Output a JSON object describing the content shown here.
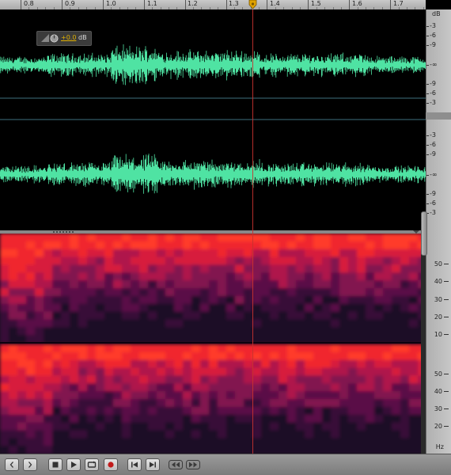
{
  "ruler": {
    "time_labels": [
      "0.8",
      "0.9",
      "1.0",
      "1.1",
      "1.2",
      "1.3",
      "1.4",
      "1.5",
      "1.6",
      "1.7"
    ]
  },
  "hud": {
    "gain_value": "+0.0",
    "gain_unit": "dB"
  },
  "amplitude_ruler": {
    "unit": "dB",
    "channel1_labels": [
      "-3",
      "-6",
      "-9",
      "-∞",
      "-9",
      "-6",
      "-3"
    ],
    "channel2_labels": [
      "-3",
      "-6",
      "-9",
      "-∞",
      "-9",
      "-6",
      "-3"
    ]
  },
  "frequency_ruler": {
    "channel1_labels": [
      "50",
      "40",
      "30",
      "20",
      "10"
    ],
    "channel2_labels": [
      "50",
      "40",
      "30",
      "20"
    ],
    "unit": "Hz"
  },
  "transport": {
    "buttons": [
      {
        "name": "nudge-left-button",
        "icon": "chevron-left-icon"
      },
      {
        "name": "nudge-right-button",
        "icon": "chevron-right-icon"
      },
      {
        "name": "stop-button",
        "icon": "stop-icon"
      },
      {
        "name": "play-button",
        "icon": "play-icon"
      },
      {
        "name": "loop-button",
        "icon": "loop-icon"
      },
      {
        "name": "record-button",
        "icon": "record-icon"
      },
      {
        "name": "go-to-start-button",
        "icon": "skip-back-icon"
      },
      {
        "name": "go-to-end-button",
        "icon": "skip-forward-icon"
      },
      {
        "name": "fast-rewind-button",
        "icon": "rewind-icon"
      },
      {
        "name": "fast-forward-button",
        "icon": "fast-forward-icon"
      }
    ]
  },
  "colors": {
    "waveform": "#4fe3a3",
    "playhead": "#c8322f",
    "gain_value": "#e0b000",
    "spectral_hot": "#ff3a2a",
    "spectral_cold": "#1a0720"
  }
}
